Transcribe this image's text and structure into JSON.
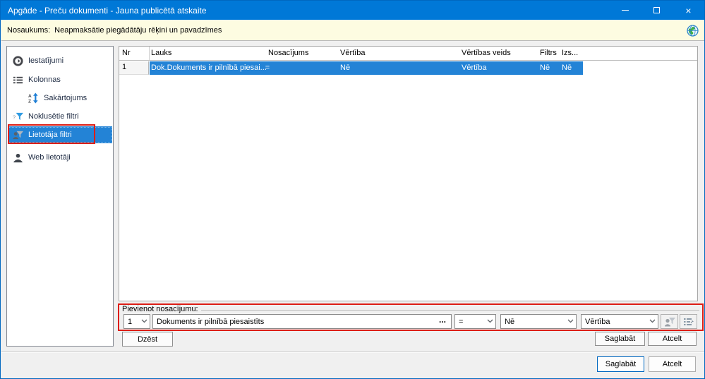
{
  "titlebar": {
    "title": "Apgāde - Preču dokumenti - Jauna publicētā atskaite"
  },
  "name_bar": {
    "label": "Nosaukums:",
    "value": "Neapmaksātie piegādātāju rēķini un pavadzīmes"
  },
  "sidebar": {
    "items": [
      {
        "label": "Iestatījumi",
        "icon": "gear-icon"
      },
      {
        "label": "Kolonnas",
        "icon": "columns-icon"
      },
      {
        "label": "Sakārtojums",
        "icon": "sort-az-icon"
      },
      {
        "label": "Noklusētie filtri",
        "icon": "default-filter-icon"
      },
      {
        "label": "Lietotāja filtri",
        "icon": "user-filter-icon",
        "selected": true
      },
      {
        "label": "Web lietotāji",
        "icon": "user-icon"
      }
    ]
  },
  "table": {
    "columns": [
      "Nr",
      "Lauks",
      "Nosacījums",
      "Vērtība",
      "Vērtības veids",
      "Filtrs",
      "Izs..."
    ],
    "row": {
      "nr": "1",
      "lauks": "Dok.Dokuments ir pilnībā piesai...",
      "nosacijums": "=",
      "vertiba": "Nē",
      "vertibas_veids": "Vērtība",
      "filtrs": "Nē",
      "izs": "Nē"
    }
  },
  "condition": {
    "legend": "Pievienot nosacījumu:",
    "index": "1",
    "field": "Dokuments ir pilnībā piesaistīts",
    "browse": "...",
    "operator": "=",
    "value": "Nē",
    "value_type": "Vērtība"
  },
  "buttons": {
    "delete": "Dzēst",
    "save_inner": "Saglabāt",
    "cancel_inner": "Atcelt",
    "save_main": "Saglabāt",
    "cancel_main": "Atcelt"
  },
  "colors": {
    "titlebar": "#0078d7",
    "selection": "#2383d6",
    "annotation": "#dd1d15",
    "name_bar_bg": "#fdfce1"
  }
}
